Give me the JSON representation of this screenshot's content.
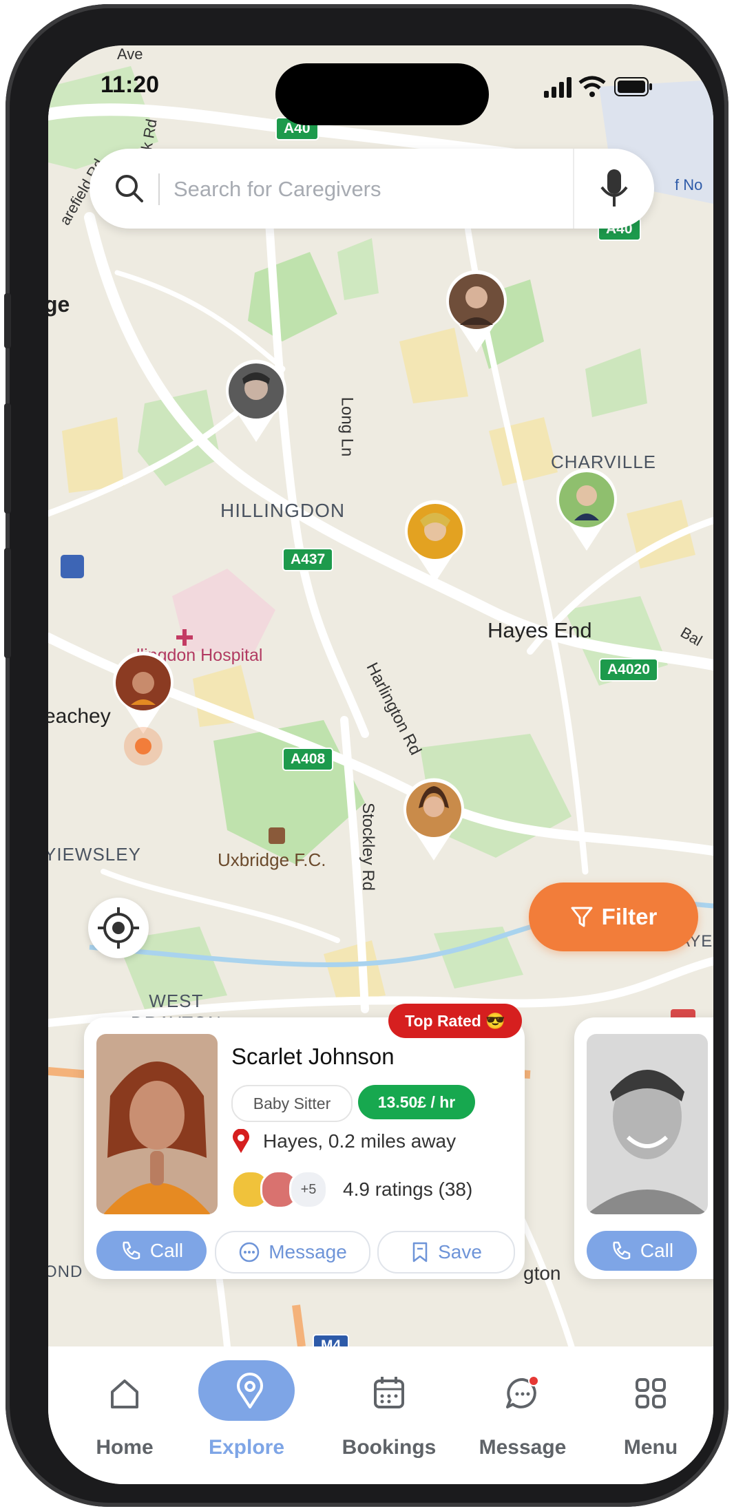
{
  "status_bar": {
    "time": "11:20"
  },
  "search": {
    "placeholder": "Search for Caregivers"
  },
  "map": {
    "labels": {
      "hillingdon": "HILLINGDON",
      "charville": "CHARVILLE",
      "hayes_end": "Hayes End",
      "hospital": "llingdon Hospital",
      "long_ln": "Long Ln",
      "harlington_rd": "Harlington Rd",
      "stockley_rd": "Stockley Rd",
      "yiewsley": "YIEWSLEY",
      "uxbridge_fc": "Uxbridge F.C.",
      "west_drayton": "WEST\nDRAYTON",
      "beachey": "eachey",
      "ge": "ge",
      "ave": "Ave",
      "bal": "Bal",
      "a40_top": "A40",
      "a40_right": "A40",
      "a437": "A437",
      "a4020": "A4020",
      "a408": "A408",
      "m4": "M4",
      "field_rd": "arefield Rd",
      "rk_rd": "rk Rd",
      "f_no": "f No",
      "ayes": "AYE",
      "ton": "gton",
      "ond": "OND"
    }
  },
  "filter": {
    "label": "Filter"
  },
  "caregivers": [
    {
      "badge": "Top Rated 😎",
      "name": "Scarlet Johnson",
      "role": "Baby Sitter",
      "rate": "13.50£ / hr",
      "location": "Hayes, 0.2 miles away",
      "more_reviewers": "+5",
      "ratings": "4.9 ratings (38)",
      "actions": {
        "call": "Call",
        "message": "Message",
        "save": "Save"
      }
    },
    {
      "actions": {
        "call": "Call"
      }
    }
  ],
  "tabs": [
    {
      "label": "Home",
      "icon": "home-icon"
    },
    {
      "label": "Explore",
      "icon": "location-pin-icon",
      "active": true
    },
    {
      "label": "Bookings",
      "icon": "calendar-icon"
    },
    {
      "label": "Message",
      "icon": "chat-bubble-icon"
    },
    {
      "label": "Menu",
      "icon": "grid-icon"
    }
  ],
  "colors": {
    "accent_blue": "#7ea5e6",
    "filter_orange": "#f27d3a",
    "rate_green": "#17a84f",
    "badge_red": "#d61f1f"
  }
}
